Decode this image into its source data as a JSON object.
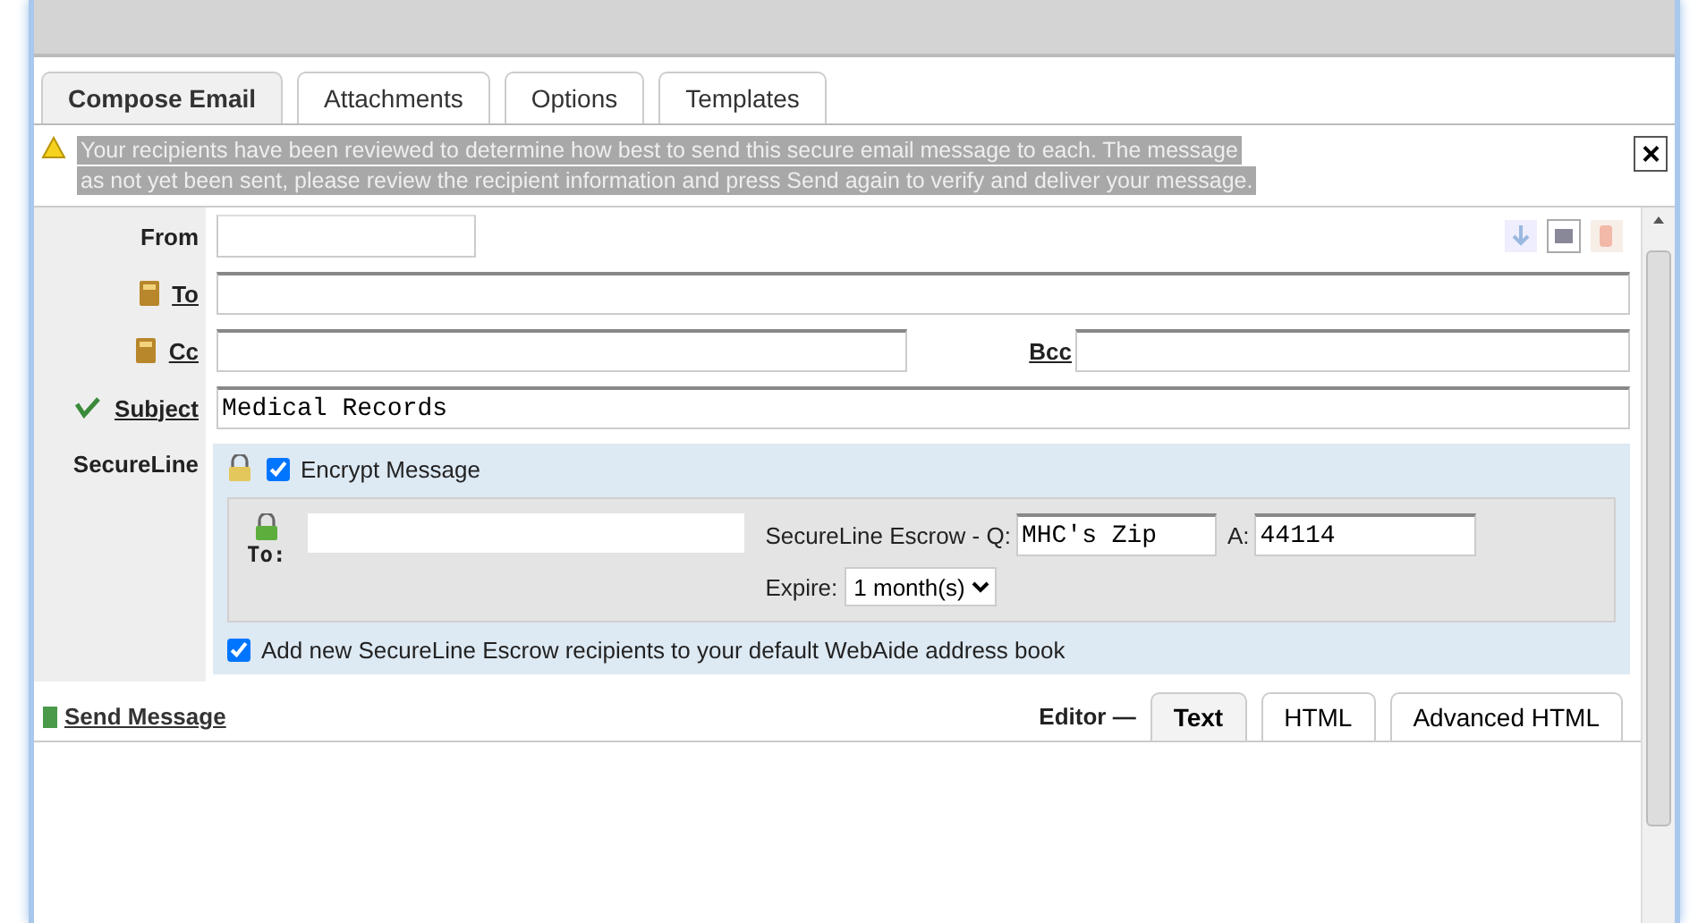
{
  "tabs": [
    {
      "label": "Compose Email",
      "selected": true
    },
    {
      "label": "Attachments",
      "selected": false
    },
    {
      "label": "Options",
      "selected": false
    },
    {
      "label": "Templates",
      "selected": false
    }
  ],
  "notice": {
    "lines": [
      "Your recipients have been reviewed to determine how best to send this secure email message to each. The message",
      "as not yet been sent, please review the recipient information and press Send again to verify and deliver your message."
    ],
    "close": "×"
  },
  "form": {
    "from": {
      "label": "From"
    },
    "to": {
      "label": "To"
    },
    "cc": {
      "label": "Cc"
    },
    "bcc": {
      "label": "Bcc"
    },
    "subject": {
      "label": "Subject",
      "value": "Medical Records"
    }
  },
  "secureline": {
    "label": "SecureLine",
    "encrypt": {
      "label": "Encrypt Message",
      "checked": true
    },
    "to_label": "To:",
    "escrow_q_label": "SecureLine Escrow - Q:",
    "escrow_q": "MHC's Zip",
    "escrow_a_label": "A:",
    "escrow_a": "44114",
    "expire_label": "Expire:",
    "expire": "1 month(s)",
    "add": {
      "label": "Add new SecureLine Escrow recipients to your default WebAide address book",
      "checked": true
    }
  },
  "send": "Send Message",
  "editor": {
    "label": "Editor —",
    "modes": [
      {
        "label": "Text",
        "selected": true
      },
      {
        "label": "HTML",
        "selected": false
      },
      {
        "label": "Advanced HTML",
        "selected": false
      }
    ]
  }
}
